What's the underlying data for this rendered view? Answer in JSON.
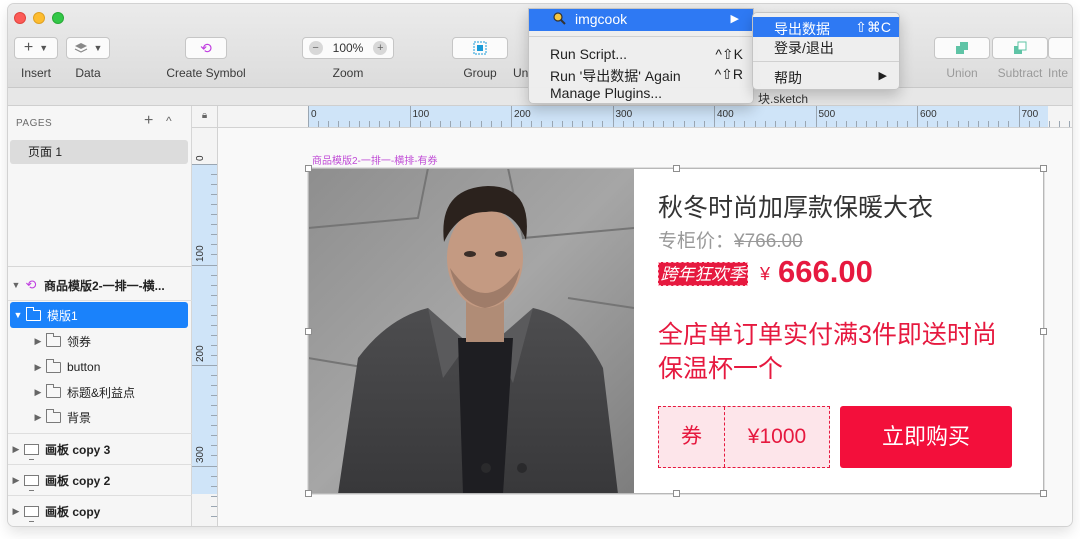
{
  "toolbar": {
    "insert_label": "Insert",
    "data_label": "Data",
    "create_symbol_label": "Create Symbol",
    "zoom_label": "Zoom",
    "zoom_value": "100%",
    "zoom_minus": "−",
    "zoom_plus": "+",
    "group_label": "Group",
    "ungroup_label_partial": "Un",
    "union_label": "Union",
    "subtract_label": "Subtract",
    "intersect_label_partial": "Inte"
  },
  "document": {
    "name_partial": "块.sketch"
  },
  "sidebar": {
    "pages_header": "PAGES",
    "add_page": "+",
    "collapse": "^",
    "page_item": "页面 1",
    "layers": [
      {
        "label": "商品模版2-一排一-横...",
        "icon": "symbol-icon",
        "arrow": "▼"
      },
      {
        "label": "模版1",
        "icon": "folder-icon",
        "arrow": "▼"
      },
      {
        "label": "领券",
        "icon": "folder-icon",
        "arrow": "▶"
      },
      {
        "label": "button",
        "icon": "folder-icon",
        "arrow": "▶"
      },
      {
        "label": "标题&利益点",
        "icon": "folder-icon",
        "arrow": "▶"
      },
      {
        "label": "背景",
        "icon": "folder-icon",
        "arrow": "▶"
      },
      {
        "label": "画板 copy 3",
        "icon": "artboard-icon",
        "arrow": "▶"
      },
      {
        "label": "画板 copy 2",
        "icon": "artboard-icon",
        "arrow": "▶"
      },
      {
        "label": "画板 copy",
        "icon": "artboard-icon",
        "arrow": "▶"
      }
    ]
  },
  "rulers": {
    "horizontal": [
      "0",
      "100",
      "200",
      "300",
      "400",
      "500",
      "600",
      "700"
    ],
    "vertical": [
      "0",
      "100",
      "200",
      "300"
    ]
  },
  "canvas": {
    "artboard_title": "商品模版2-一排一-横排-有券",
    "product": {
      "title": "秋冬时尚加厚款保暖大衣",
      "orig_price_label": "专柜价：",
      "orig_price_value": "¥766.00",
      "promo_tag": "跨年狂欢季",
      "currency": "¥",
      "price": "666.00",
      "promo_text": "全店单订单实付满3件即送时尚保温杯一个",
      "coupon_label": "券",
      "coupon_value": "¥1000",
      "buy_button": "立即购买"
    }
  },
  "plugins_menu": {
    "highlighted": "imgcook",
    "highlighted_arrow": "▶",
    "items": [
      {
        "label": "Run Script...",
        "shortcut": "^⇧K"
      },
      {
        "label": "Run '导出数据' Again",
        "shortcut": "^⇧R"
      },
      {
        "label": "Manage Plugins...",
        "shortcut": ""
      }
    ]
  },
  "imgcook_submenu": {
    "highlighted": "导出数据",
    "highlighted_shortcut": "⇧⌘C",
    "items": [
      {
        "label": "登录/退出",
        "arrow": ""
      },
      {
        "label": "帮助",
        "arrow": "▶"
      }
    ]
  },
  "colors": {
    "accent_blue": "#2e79f3",
    "brand_red": "#e6193f",
    "selection_blue": "#1a82fb",
    "symbol_purple": "#c04ad6"
  }
}
